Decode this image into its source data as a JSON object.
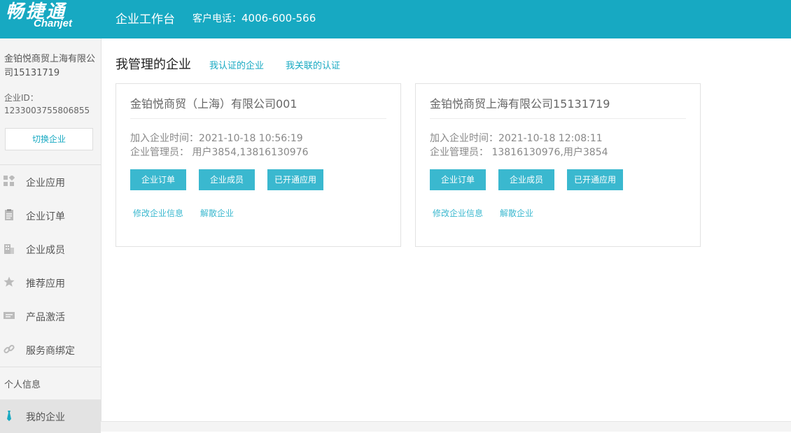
{
  "header": {
    "logo_cn": "畅捷通",
    "logo_en": "Chanjet",
    "title": "企业工作台",
    "hotline_label": "客户电话：",
    "hotline_number": "4006-600-566"
  },
  "sidebar": {
    "company_name": "金铂悦商贸上海有限公司15131719",
    "company_id_label": "企业ID：",
    "company_id": "1233003755806855",
    "switch_button": "切换企业",
    "items": [
      {
        "label": "企业应用",
        "icon": "grid-icon"
      },
      {
        "label": "企业订单",
        "icon": "clipboard-icon"
      },
      {
        "label": "企业成员",
        "icon": "building-icon"
      },
      {
        "label": "推荐应用",
        "icon": "star-icon"
      },
      {
        "label": "产品激活",
        "icon": "ticket-icon"
      },
      {
        "label": "服务商绑定",
        "icon": "link-icon"
      }
    ],
    "personal_section": "个人信息",
    "personal_items": [
      {
        "label": "我的企业",
        "icon": "tie-icon",
        "active": true
      }
    ]
  },
  "tabs": {
    "active": "我管理的企业",
    "certified": "我认证的企业",
    "associated": "我关联的认证"
  },
  "cards": [
    {
      "name": "金铂悦商贸（上海）有限公司001",
      "join_label": "加入企业时间：",
      "join_time": "2021-10-18 10:56:19",
      "admin_label": "企业管理员：",
      "admins": "用户3854,13816130976",
      "buttons": [
        "企业订单",
        "企业成员",
        "已开通应用"
      ],
      "links": [
        "修改企业信息",
        "解散企业"
      ]
    },
    {
      "name": "金铂悦商贸上海有限公司15131719",
      "join_label": "加入企业时间：",
      "join_time": "2021-10-18 12:08:11",
      "admin_label": "企业管理员：",
      "admins": "13816130976,用户3854",
      "buttons": [
        "企业订单",
        "企业成员",
        "已开通应用"
      ],
      "links": [
        "修改企业信息",
        "解散企业"
      ]
    }
  ],
  "colors": {
    "brand": "#17a9c2",
    "button": "#3ab8cf",
    "sidebar_bg": "#f4f4f4"
  }
}
